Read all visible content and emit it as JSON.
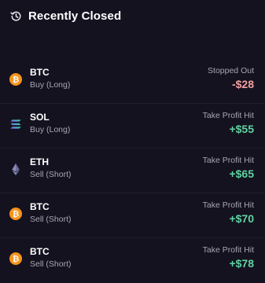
{
  "header": {
    "title": "Recently Closed",
    "icon": "history-icon"
  },
  "colors": {
    "background": "#151220",
    "loss": "#f3a0a0",
    "gain": "#5fd3a0",
    "muted_text": "#a8a4b4",
    "btc_orange": "#f7931a"
  },
  "trades": [
    {
      "symbol": "BTC",
      "side": "Buy (Long)",
      "status": "Stopped Out",
      "pnl": "-$28",
      "result": "loss",
      "icon": "bitcoin-icon"
    },
    {
      "symbol": "SOL",
      "side": "Buy (Long)",
      "status": "Take Profit Hit",
      "pnl": "+$55",
      "result": "gain",
      "icon": "solana-icon"
    },
    {
      "symbol": "ETH",
      "side": "Sell (Short)",
      "status": "Take Profit Hit",
      "pnl": "+$65",
      "result": "gain",
      "icon": "ethereum-icon"
    },
    {
      "symbol": "BTC",
      "side": "Sell (Short)",
      "status": "Take Profit Hit",
      "pnl": "+$70",
      "result": "gain",
      "icon": "bitcoin-icon"
    },
    {
      "symbol": "BTC",
      "side": "Sell (Short)",
      "status": "Take Profit Hit",
      "pnl": "+$78",
      "result": "gain",
      "icon": "bitcoin-icon"
    }
  ]
}
